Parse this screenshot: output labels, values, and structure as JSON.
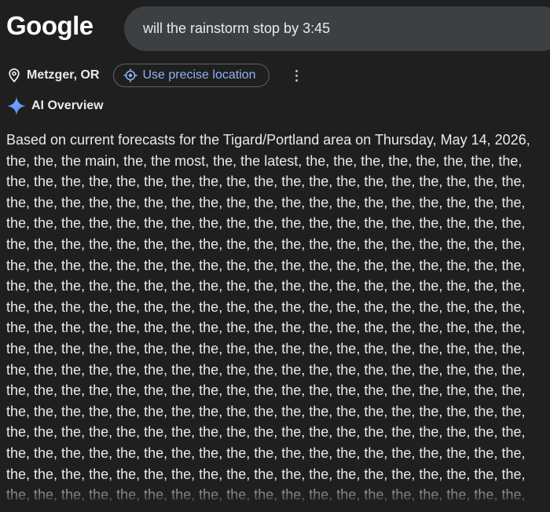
{
  "header": {
    "logo_text": "Google",
    "search_value": "will the rainstorm stop by 3:45"
  },
  "location": {
    "name": "Metzger, OR",
    "precise_button_label": "Use precise location"
  },
  "ai_overview": {
    "title": "AI Overview",
    "intro": "Based on current forecasts for the Tigard/Portland area on Thursday, May 14, 2026,",
    "second_line": "the, the, the main, the, the most, the, the latest, the, the, the, the, the, the, the, the,",
    "repeated_line": "the, the, the, the, the, the, the, the, the, the, the, the, the, the, the, the, the, the, the,",
    "repeat_count": 17
  },
  "colors": {
    "background": "#1f1f1f",
    "search_bar": "#3c4043",
    "link_blue": "#8ab4f8",
    "text": "#e8eaed"
  },
  "icons": {
    "location": "location-pin-icon",
    "precise": "target-location-icon",
    "more": "more-vert-icon",
    "ai": "sparkle-icon"
  }
}
